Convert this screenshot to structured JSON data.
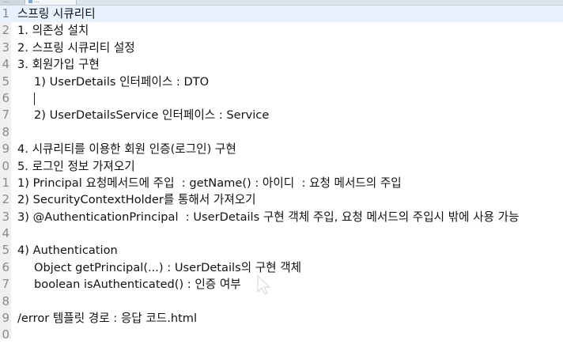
{
  "tabs": [
    {
      "label": "...",
      "active": false
    },
    {
      "label": "...",
      "active": true
    }
  ],
  "lines": [
    {
      "num": "1",
      "text": "스프링 시큐리티",
      "indent": false
    },
    {
      "num": "2",
      "text": "1. 의존성 설치",
      "indent": false
    },
    {
      "num": "3",
      "text": "2. 스프링 시큐리티 설정",
      "indent": false
    },
    {
      "num": "4",
      "text": "3. 회원가입 구현",
      "indent": false
    },
    {
      "num": "5",
      "text": "1) UserDetails 인터페이스 : DTO",
      "indent": true
    },
    {
      "num": "6",
      "text": "",
      "indent": true
    },
    {
      "num": "7",
      "text": "2) UserDetailsService 인터페이스 : Service",
      "indent": true
    },
    {
      "num": "8",
      "text": "",
      "indent": false
    },
    {
      "num": "9",
      "text": "4. 시큐리티를 이용한 회원 인증(로그인) 구현",
      "indent": false
    },
    {
      "num": "0",
      "text": "5. 로그인 정보 가져오기",
      "indent": false
    },
    {
      "num": "1",
      "text": "1) Principal 요청메서드에 주입  : getName() : 아이디  : 요청 메서드의 주입",
      "indent": false
    },
    {
      "num": "2",
      "text": "2) SecurityContextHolder를 통해서 가져오기",
      "indent": false
    },
    {
      "num": "3",
      "text": "3) @AuthenticationPrincipal  : UserDetails 구현 객체 주입, 요청 메서드의 주입시 밖에 사용 가능",
      "indent": false
    },
    {
      "num": "4",
      "text": "",
      "indent": false
    },
    {
      "num": "5",
      "text": "4) Authentication",
      "indent": false
    },
    {
      "num": "6",
      "text": "Object getPrincipal(...) : UserDetails의 구현 객체",
      "indent": true
    },
    {
      "num": "7",
      "text": "boolean isAuthenticated() : 인증 여부",
      "indent": true
    },
    {
      "num": "8",
      "text": "",
      "indent": false
    },
    {
      "num": "9",
      "text": "/error 템플릿 경로 : 응답 코드.html",
      "indent": false
    },
    {
      "num": "0",
      "text": "",
      "indent": false
    }
  ],
  "editor": {
    "current_line_index": 0,
    "caret_line_index": 5
  }
}
